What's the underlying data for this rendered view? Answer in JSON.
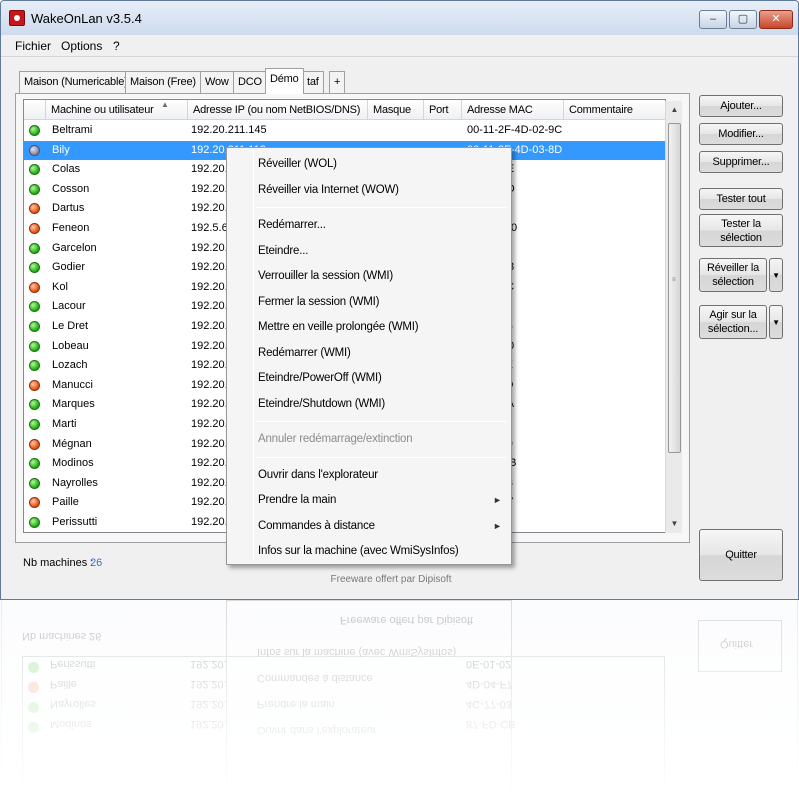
{
  "window": {
    "title": "WakeOnLan v3.5.4"
  },
  "titlebar_buttons": {
    "minimize": "–",
    "maximize": "▢",
    "close": "✕"
  },
  "menu": [
    "Fichier",
    "Options",
    "?"
  ],
  "tabs": [
    "Maison (Numericable)",
    "Maison (Free)",
    "Wow",
    "DCO",
    "Démo",
    "taf",
    "+"
  ],
  "active_tab": "Démo",
  "list": {
    "columns": [
      "Machine ou utilisateur",
      "Adresse IP (ou nom NetBIOS/DNS)",
      "Masque",
      "Port",
      "Adresse MAC",
      "Commentaire"
    ],
    "rows": [
      {
        "name": "Beltrami",
        "ip": "192.20.211.145",
        "mac": "00-11-2F-4D-02-9C",
        "status": "green"
      },
      {
        "name": "Bily",
        "ip": "192.20.211.112",
        "mac": "00-11-2F-4D-03-8D",
        "status": "grey",
        "selected": true
      },
      {
        "name": "Colas",
        "ip": "192.20.",
        "mac": "F9-43-AE",
        "status": "green"
      },
      {
        "name": "Cosson",
        "ip": "192.20.",
        "mac": "90-39-CD",
        "status": "green"
      },
      {
        "name": "Dartus",
        "ip": "192.20.",
        "mac": "54-88-A8",
        "status": "red"
      },
      {
        "name": "Feneon",
        "ip": "192.5.6",
        "mac": "B0-DD-B0",
        "status": "red"
      },
      {
        "name": "Garcelon",
        "ip": "192.20.",
        "mac": "90-6F-53",
        "status": "green"
      },
      {
        "name": "Godier",
        "ip": "192.20.",
        "mac": "4D-02-A8",
        "status": "green"
      },
      {
        "name": "Kol",
        "ip": "192.20.",
        "mac": "B6-16-3C",
        "status": "red"
      },
      {
        "name": "Lacour",
        "ip": "192.20.",
        "mac": "90-3A-74",
        "status": "green"
      },
      {
        "name": "Le Dret",
        "ip": "192.20.",
        "mac": "4D-03-44",
        "status": "green"
      },
      {
        "name": "Lobeau",
        "ip": "192.20.",
        "mac": "4D-02-B0",
        "status": "green"
      },
      {
        "name": "Lozach",
        "ip": "192.20.",
        "mac": "27-8F-0E",
        "status": "green"
      },
      {
        "name": "Manucci",
        "ip": "192.20.",
        "mac": "90-6F-7D",
        "status": "red"
      },
      {
        "name": "Marques",
        "ip": "192.20.",
        "mac": "6F-B4-0A",
        "status": "green"
      },
      {
        "name": "Marti",
        "ip": "192.20.",
        "mac": "F9-41-37",
        "status": "green"
      },
      {
        "name": "Mégnan",
        "ip": "192.20.",
        "mac": "27-8F-E9",
        "status": "red"
      },
      {
        "name": "Modinos",
        "ip": "192.20.",
        "mac": "87-FD-CB",
        "status": "green"
      },
      {
        "name": "Nayrolles",
        "ip": "192.20.",
        "mac": "4C-77-03",
        "status": "green"
      },
      {
        "name": "Paille",
        "ip": "192.20.",
        "mac": "4D-04-F7",
        "status": "red"
      },
      {
        "name": "Perissutti",
        "ip": "192.20.",
        "mac": "0E-01-02",
        "status": "green"
      }
    ]
  },
  "buttons": {
    "add": "Ajouter...",
    "modify": "Modifier...",
    "delete": "Supprimer...",
    "test_all": "Tester tout",
    "test_selection_1": "Tester la",
    "test_selection_2": "sélection",
    "wake_selection_1": "Réveiller la",
    "wake_selection_2": "sélection",
    "act_selection_1": "Agir sur la",
    "act_selection_2": "sélection...",
    "quit": "Quitter",
    "dropdown_arrow": "▼"
  },
  "status": {
    "label": "Nb machines :",
    "count": "26"
  },
  "footer": {
    "line1": "",
    "line2": "Freeware offert par Dipisoft"
  },
  "context_menu": {
    "items": [
      {
        "label": "Réveiller (WOL)",
        "disabled": false,
        "submenu": false
      },
      {
        "label": "Réveiller via Internet (WOW)",
        "disabled": false,
        "submenu": false
      },
      {
        "separator": true
      },
      {
        "label": "Redémarrer...",
        "disabled": false,
        "submenu": false
      },
      {
        "label": "Eteindre...",
        "disabled": false,
        "submenu": false
      },
      {
        "label": "Verrouiller la session (WMI)",
        "disabled": false,
        "submenu": false
      },
      {
        "label": "Fermer la session (WMI)",
        "disabled": false,
        "submenu": false
      },
      {
        "label": "Mettre en veille prolongée (WMI)",
        "disabled": false,
        "submenu": false
      },
      {
        "label": "Redémarrer (WMI)",
        "disabled": false,
        "submenu": false
      },
      {
        "label": "Eteindre/PowerOff (WMI)",
        "disabled": false,
        "submenu": false
      },
      {
        "label": "Eteindre/Shutdown (WMI)",
        "disabled": false,
        "submenu": false
      },
      {
        "separator": true
      },
      {
        "label": "Annuler redémarrage/extinction",
        "disabled": true,
        "submenu": false
      },
      {
        "separator": true
      },
      {
        "label": "Ouvrir dans l'explorateur",
        "disabled": false,
        "submenu": false
      },
      {
        "label": "Prendre la main",
        "disabled": false,
        "submenu": true
      },
      {
        "label": "Commandes à distance",
        "disabled": false,
        "submenu": true
      },
      {
        "label": "Infos sur la machine (avec WmiSysInfos)",
        "disabled": false,
        "submenu": false
      }
    ],
    "submenu_arrow": "►"
  },
  "colors": {
    "selection": "#3399ff",
    "status_green": "#28b818",
    "status_red": "#ee5a1a",
    "status_grey": "#8d8fb0",
    "count_blue": "#2d73d7"
  }
}
